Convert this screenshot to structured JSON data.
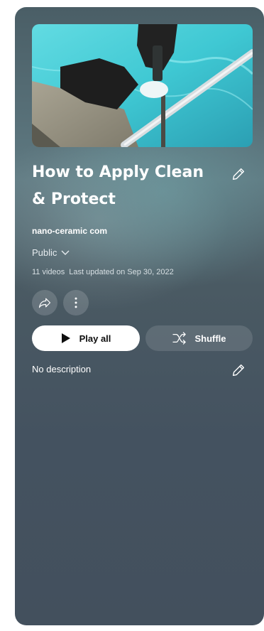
{
  "playlist": {
    "title": "How to Apply Clean & Protect",
    "owner": "nano-ceramic com",
    "privacy": "Public",
    "video_count": "11 videos",
    "last_updated": "Last updated on Sep 30, 2022",
    "description": "No description"
  },
  "actions": {
    "play_all": "Play all",
    "shuffle": "Shuffle"
  },
  "icons": {
    "edit_title": "pencil-icon",
    "edit_description": "pencil-icon",
    "privacy_dropdown": "chevron-down-icon",
    "share": "share-icon",
    "more": "more-vert-icon",
    "play": "play-icon",
    "shuffle": "shuffle-icon"
  },
  "colors": {
    "panel": "#4a5a63",
    "pool_water": "#3fc8d3",
    "play_button": "#ffffff"
  }
}
